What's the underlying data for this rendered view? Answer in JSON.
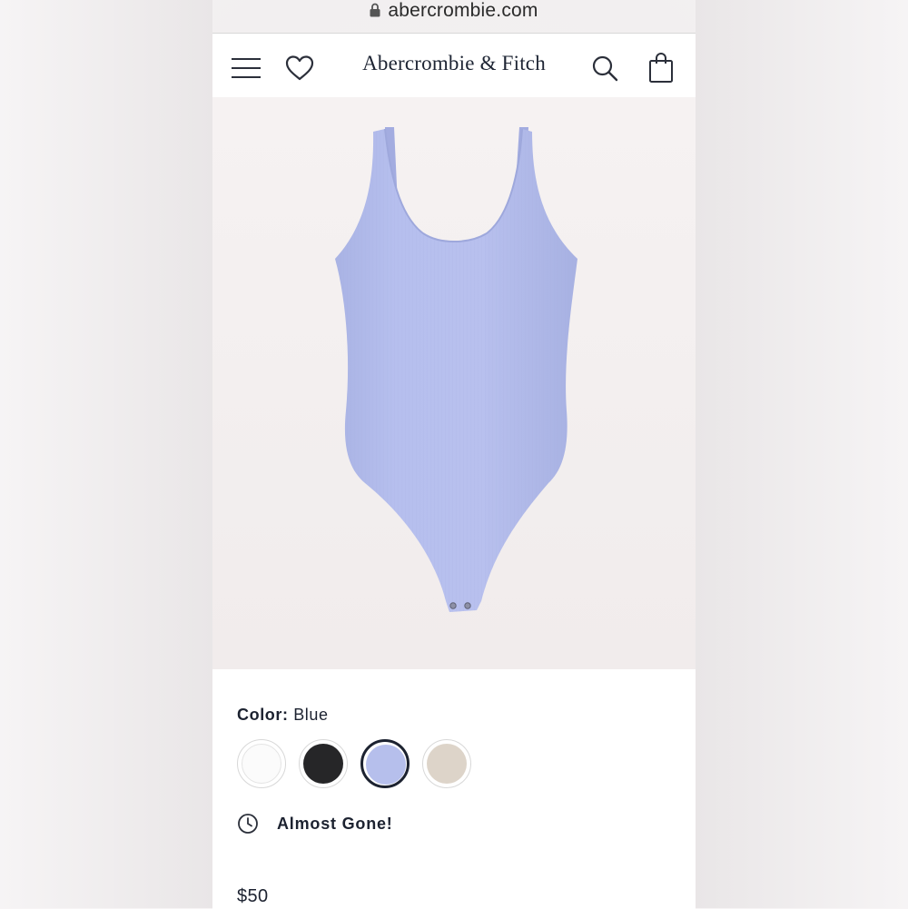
{
  "browser": {
    "url": "abercrombie.com",
    "icon": "lock-icon"
  },
  "header": {
    "brand": "Abercrombie & Fitch",
    "icons": [
      "menu-icon",
      "heart-icon",
      "search-icon",
      "shopping-bag-icon"
    ]
  },
  "product": {
    "image": "ribbed-scoopneck-bodysuit",
    "image_color": "#b3bdea",
    "color_label": "Color:",
    "color_value": "Blue",
    "swatches": [
      {
        "name": "White",
        "color": "#fbfbfb",
        "selected": false
      },
      {
        "name": "Black",
        "color": "#262628",
        "selected": false
      },
      {
        "name": "Blue",
        "color": "#b6bfec",
        "selected": true
      },
      {
        "name": "Tan",
        "color": "#ddd4c9",
        "selected": false
      }
    ],
    "stock_status": "Almost Gone!",
    "stock_icon": "clock-icon",
    "price": "$50"
  }
}
